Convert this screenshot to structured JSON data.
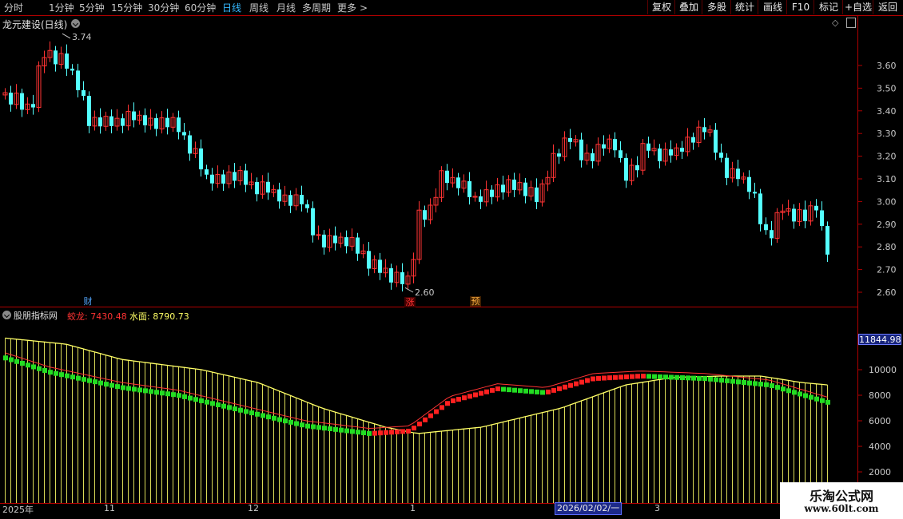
{
  "toolbar": {
    "periods": [
      "分时",
      "1分钟",
      "5分钟",
      "15分钟",
      "30分钟",
      "60分钟",
      "日线",
      "周线",
      "月线",
      "多周期",
      "更多"
    ],
    "active_period": "日线",
    "more_arrow": ">",
    "buttons": [
      "复权",
      "叠加",
      "多股",
      "统计",
      "画线",
      "F10",
      "标记",
      "+自选",
      "返回"
    ]
  },
  "main_chart": {
    "title": "龙元建设(日线)",
    "high_label": "3.74",
    "low_label": "2.60",
    "y_ticks": [
      "3.60",
      "3.50",
      "3.40",
      "3.30",
      "3.20",
      "3.10",
      "3.00",
      "2.90",
      "2.80",
      "2.70",
      "2.60"
    ],
    "markers": [
      "财",
      "涨",
      "预"
    ],
    "colors": {
      "up": "#ff3333",
      "down": "#54ffff",
      "grid": "#b00000"
    }
  },
  "indicator": {
    "name": "股朋指标网",
    "series": [
      {
        "name": "蛟龙",
        "value": "7430.48",
        "color": "#ff3333"
      },
      {
        "name": "水面",
        "value": "8790.73",
        "color": "#ffff66"
      }
    ],
    "y_ticks": [
      "10000",
      "8000",
      "6000",
      "4000",
      "2000"
    ],
    "current_value": "11844.98"
  },
  "x_axis": {
    "labels": [
      "2025年",
      "11",
      "12",
      "1",
      "3"
    ],
    "cursor_date": "2026/02/02/一"
  },
  "watermark": {
    "title": "乐淘公式网",
    "url": "www.60lt.com"
  }
}
